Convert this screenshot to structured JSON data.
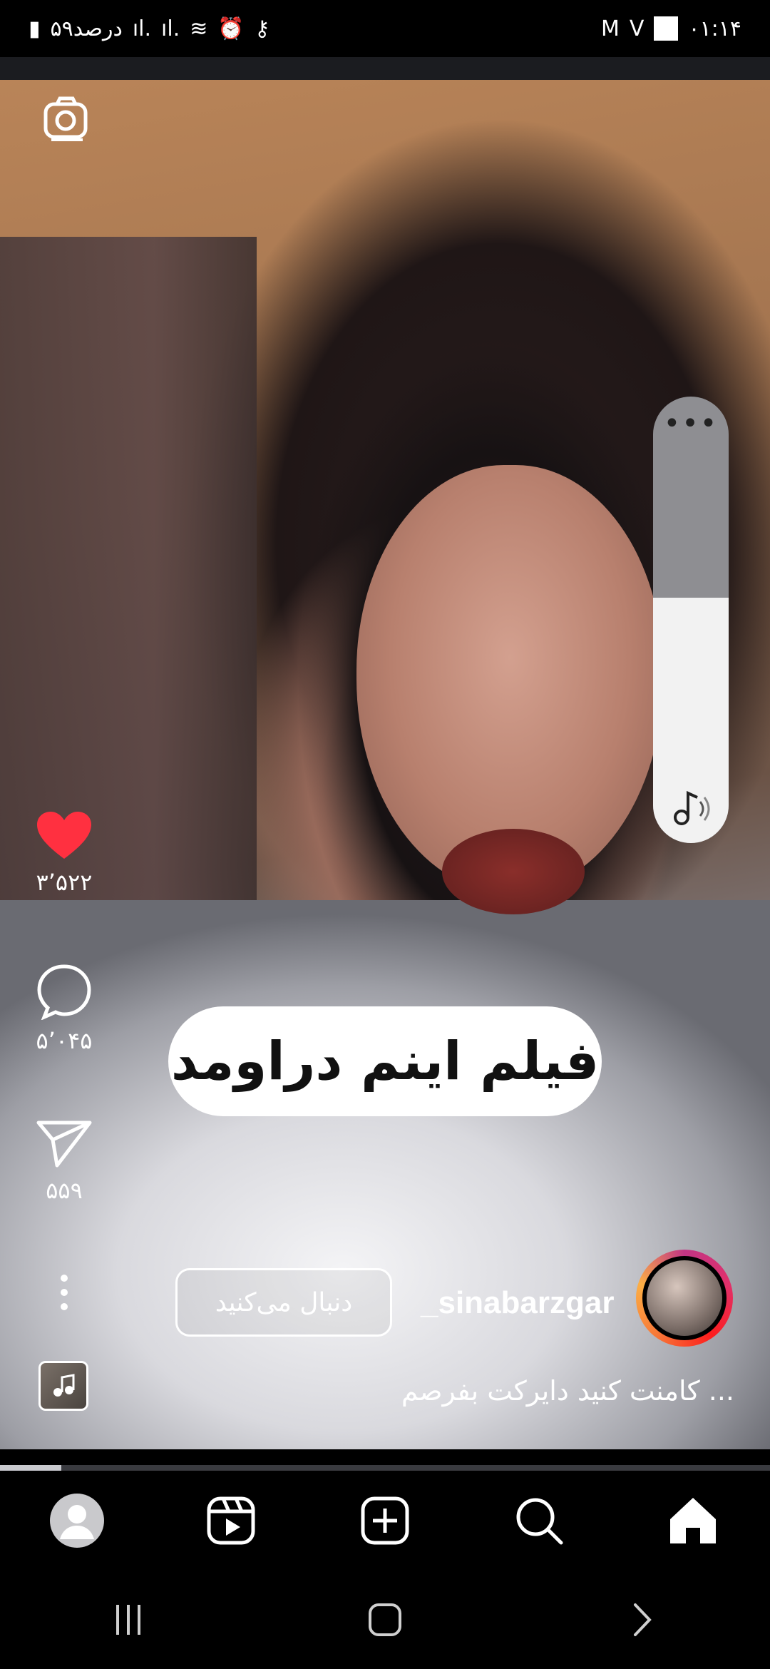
{
  "status_bar": {
    "time": "۰۱:۱۴",
    "battery_text": "۵۹درصد",
    "indicators": [
      "gmail-icon",
      "v-icon",
      "white-square-icon"
    ],
    "left_icons": [
      "signal-icon",
      "signal-icon",
      "wifi-icon",
      "alarm-icon",
      "key-icon"
    ]
  },
  "video": {
    "caption_sticker": "فیلم اینم دراومد",
    "sound_slider": {
      "level": 0.55,
      "dots_label": "•••",
      "icon": "music-note-icon"
    }
  },
  "actions": {
    "likes": "۳٬۵۲۲",
    "comments": "۵٬۰۴۵",
    "shares": "۵۵۹",
    "like_color": "#ff3040"
  },
  "profile": {
    "username": "_sinabarzgar",
    "follow_label": "دنبال می‌کنید",
    "caption": "کامنت کنید دایرکت بفرصم ..."
  },
  "progress": {
    "value": 0.08
  },
  "bottom_nav": [
    "profile-icon",
    "reels-icon",
    "create-icon",
    "search-icon",
    "home-icon"
  ]
}
